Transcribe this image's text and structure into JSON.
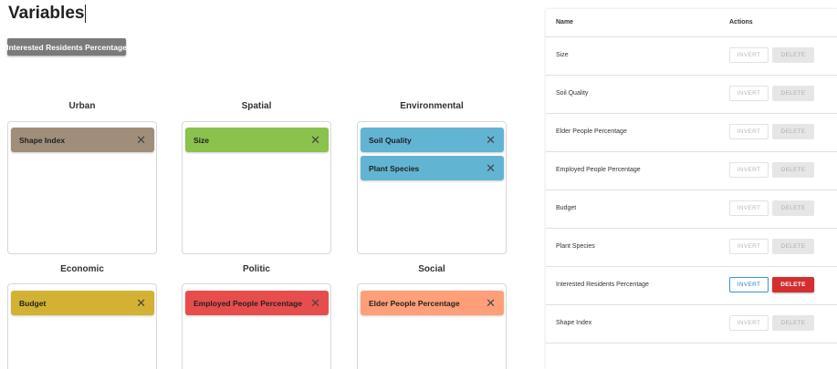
{
  "page": {
    "title": "Variables"
  },
  "selected_chip": {
    "label": "Interested Residents Percentage"
  },
  "categories": [
    {
      "title": "Urban",
      "items": [
        {
          "label": "Shape Index",
          "color": "#a08e7b"
        }
      ]
    },
    {
      "title": "Spatial",
      "items": [
        {
          "label": "Size",
          "color": "#8bc14d"
        }
      ]
    },
    {
      "title": "Environmental",
      "items": [
        {
          "label": "Soil Quality",
          "color": "#62b4d3"
        },
        {
          "label": "Plant Species",
          "color": "#62b4d3"
        }
      ]
    },
    {
      "title": "Economic",
      "items": [
        {
          "label": "Budget",
          "color": "#d3b233"
        }
      ]
    },
    {
      "title": "Politic",
      "items": [
        {
          "label": "Employed People Percentage",
          "color": "#e84d4d"
        }
      ]
    },
    {
      "title": "Social",
      "items": [
        {
          "label": "Elder People Percentage",
          "color": "#ff9f79"
        }
      ]
    }
  ],
  "close_glyph": "✕",
  "table": {
    "headers": {
      "name": "Name",
      "actions": "Actions"
    },
    "invert_label": "INVERT",
    "delete_label": "DELETE",
    "rows": [
      {
        "name": "Size",
        "active": false
      },
      {
        "name": "Soil Quality",
        "active": false
      },
      {
        "name": "Elder People Percentage",
        "active": false
      },
      {
        "name": "Employed People Percentage",
        "active": false
      },
      {
        "name": "Budget",
        "active": false
      },
      {
        "name": "Plant Species",
        "active": false
      },
      {
        "name": "Interested Residents Percentage",
        "active": true
      },
      {
        "name": "Shape Index",
        "active": false
      }
    ]
  }
}
